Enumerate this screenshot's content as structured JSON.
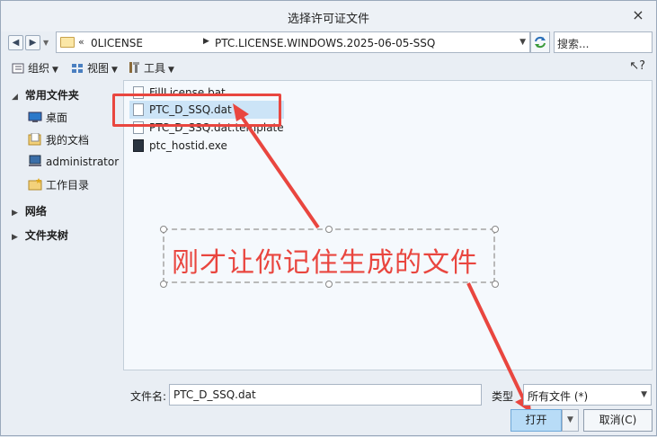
{
  "window": {
    "title": "选择许可证文件",
    "close_glyph": "×"
  },
  "address_bar": {
    "back_glyph": "◀",
    "forward_glyph": "▶",
    "path": [
      "0LICENSE",
      "PTC.LICENSE.WINDOWS.2025-06-05-SSQ"
    ],
    "separator_1": "«",
    "separator_2": "▶",
    "dropdown_glyph": "▼",
    "search_placeholder": "搜索..."
  },
  "toolbar": {
    "organize": "组织",
    "view": "视图",
    "tools": "工具",
    "caret": "▼",
    "help_glyph": "↖?"
  },
  "sidebar": {
    "groups": [
      {
        "label": "常用文件夹",
        "expanded": true,
        "toggle_glyph": "◢",
        "items": [
          {
            "label": "桌面",
            "icon": "desktop-icon"
          },
          {
            "label": "我的文档",
            "icon": "documents-icon"
          },
          {
            "label": "administrator",
            "icon": "computer-icon"
          },
          {
            "label": "工作目录",
            "icon": "working-directory-icon"
          }
        ]
      },
      {
        "label": "网络",
        "expanded": false,
        "toggle_glyph": "▶",
        "items": []
      },
      {
        "label": "文件夹树",
        "expanded": false,
        "toggle_glyph": "▶",
        "items": []
      }
    ]
  },
  "files": [
    {
      "name": "FillLicense.bat",
      "icon": "batch-file-icon",
      "selected": false
    },
    {
      "name": "PTC_D_SSQ.dat",
      "icon": "dat-file-icon",
      "selected": true
    },
    {
      "name": "PTC_D_SSQ.dat.template",
      "icon": "file-icon",
      "selected": false
    },
    {
      "name": "ptc_hostid.exe",
      "icon": "exe-file-icon",
      "selected": false
    }
  ],
  "annotation": {
    "text": "刚才让你记住生成的文件",
    "color": "#e9463f"
  },
  "footer": {
    "filename_label": "文件名:",
    "filename_value": "PTC_D_SSQ.dat",
    "type_label": "类型",
    "type_value": "所有文件 (*)",
    "dropdown_glyph": "▼",
    "open_label": "打开",
    "cancel_label": "取消(C)"
  },
  "colors": {
    "accent": "#b8dcf7",
    "selection": "#cce4f7",
    "annotation_red": "#e9463f"
  }
}
